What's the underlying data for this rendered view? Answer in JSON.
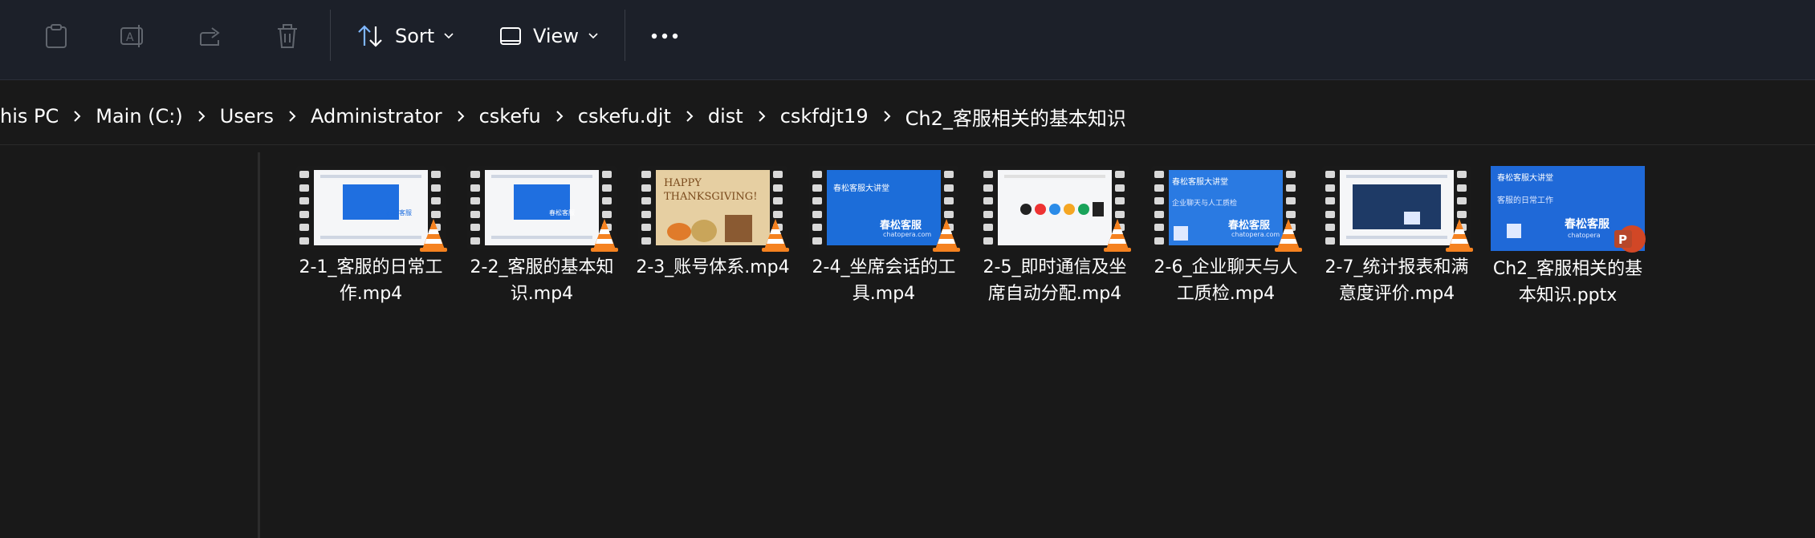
{
  "toolbar": {
    "paste_icon": "clipboard-icon",
    "rename_icon": "rename-icon",
    "share_icon": "share-icon",
    "delete_icon": "trash-icon",
    "sort_label": "Sort",
    "view_label": "View",
    "more_icon": "ellipsis-icon"
  },
  "breadcrumb": [
    "his PC",
    "Main (C:)",
    "Users",
    "Administrator",
    "cskefu",
    "cskefu.djt",
    "dist",
    "cskfdjt19",
    "Ch2_客服相关的基本知识"
  ],
  "files": [
    {
      "name": "2-1_客服的日常工作.mp4",
      "type": "video",
      "thumb_text": "春松客服"
    },
    {
      "name": "2-2_客服的基本知识.mp4",
      "type": "video",
      "thumb_text": "春松客服"
    },
    {
      "name": "2-3_账号体系.mp4",
      "type": "video",
      "thumb_text": "HAPPY THANKSGIVING!"
    },
    {
      "name": "2-4_坐席会话的工具.mp4",
      "type": "video",
      "thumb_text": "春松客服大讲堂",
      "thumb_brand": "春松客服",
      "thumb_sub": "chatopera.com"
    },
    {
      "name": "2-5_即时通信及坐席自动分配.mp4",
      "type": "video",
      "thumb_text": ""
    },
    {
      "name": "2-6_企业聊天与人工质检.mp4",
      "type": "video",
      "thumb_text": "春松客服大讲堂",
      "thumb_line2": "企业聊天与人工质检",
      "thumb_brand": "春松客服",
      "thumb_sub": "chatopera.com"
    },
    {
      "name": "2-7_统计报表和满意度评价.mp4",
      "type": "video",
      "thumb_text": ""
    },
    {
      "name": "Ch2_客服相关的基本知识.pptx",
      "type": "pptx",
      "thumb_text": "春松客服大讲堂",
      "thumb_line2": "客服的日常工作",
      "thumb_brand": "春松客服",
      "thumb_sub": "chatopera"
    }
  ],
  "colors": {
    "toolbar_bg": "#1c2029",
    "content_bg": "#191919",
    "vlc_orange": "#f58220",
    "ppt_red": "#d24726"
  }
}
